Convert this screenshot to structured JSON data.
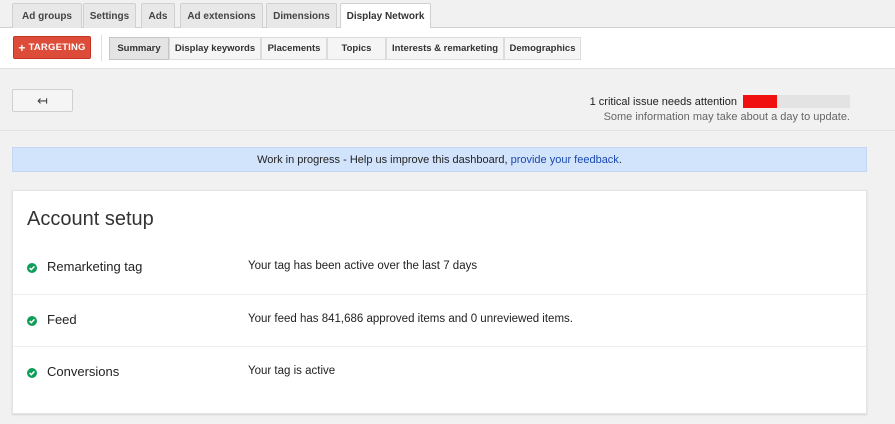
{
  "tabs": [
    {
      "label": "Ad groups",
      "active": false
    },
    {
      "label": "Settings",
      "active": false
    },
    {
      "label": "Ads",
      "active": false
    },
    {
      "label": "Ad extensions",
      "active": false
    },
    {
      "label": "Dimensions",
      "active": false
    },
    {
      "label": "Display Network",
      "active": true
    }
  ],
  "toolbar": {
    "targeting_label": "TARGETING",
    "targeting_icon": "plus-icon",
    "accent_color": "#dd4b39"
  },
  "subtabs": [
    {
      "label": "Summary",
      "active": true
    },
    {
      "label": "Display keywords",
      "active": false
    },
    {
      "label": "Placements",
      "active": false
    },
    {
      "label": "Topics",
      "active": false
    },
    {
      "label": "Interests & remarketing",
      "active": false
    },
    {
      "label": "Demographics",
      "active": false
    }
  ],
  "back": {
    "icon": "back-arrow-icon",
    "glyph": "↤"
  },
  "status": {
    "issue_text": "1 critical issue needs attention",
    "issue_fraction": 0.32,
    "issue_color": "#f01010",
    "update_note": "Some information may take about a day to update."
  },
  "banner": {
    "text": "Work in progress - Help us improve this dashboard,",
    "link": "provide your feedback",
    "suffix": ".",
    "bg_color": "#d2e3fc"
  },
  "account_setup": {
    "title": "Account setup",
    "status_color": "#0f9d58",
    "rows": [
      {
        "label": "Remarketing tag",
        "description": "Your tag has been active over the last 7 days",
        "status_icon": "check-circle-icon"
      },
      {
        "label": "Feed",
        "description": "Your feed has 841,686 approved items and 0 unreviewed items.",
        "status_icon": "check-circle-icon"
      },
      {
        "label": "Conversions",
        "description": "Your tag is active",
        "status_icon": "check-circle-icon"
      }
    ]
  }
}
